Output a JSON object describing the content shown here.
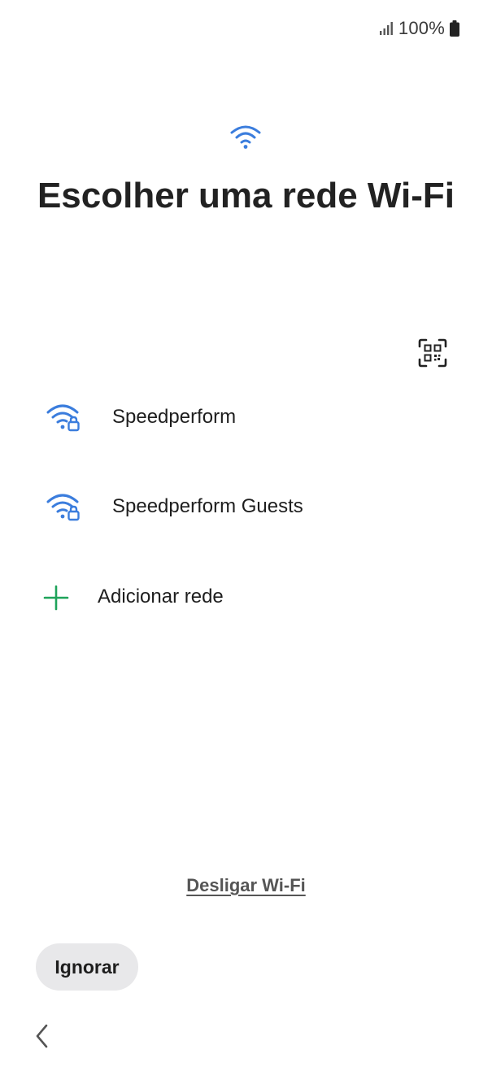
{
  "status_bar": {
    "battery_text": "100%",
    "signal_icon": "signal-bars-icon",
    "battery_icon": "battery-full-icon"
  },
  "header": {
    "icon": "wifi-icon",
    "title": "Escolher uma rede Wi-Fi"
  },
  "qr_scan": {
    "icon": "qr-code-scan-icon"
  },
  "networks": [
    {
      "name": "Speedperform",
      "icon": "wifi-lock-icon",
      "secured": true
    },
    {
      "name": "Speedperform Guests",
      "icon": "wifi-lock-icon",
      "secured": true
    }
  ],
  "add_network": {
    "label": "Adicionar rede",
    "icon": "plus-icon"
  },
  "footer": {
    "wifi_off_label": "Desligar Wi-Fi",
    "skip_label": "Ignorar",
    "back_icon": "chevron-left-icon"
  },
  "colors": {
    "accent_blue": "#3b7ddd",
    "add_green": "#1ea35a",
    "skip_button_bg": "#e8e8ea",
    "text_primary": "#1e1e1e"
  }
}
